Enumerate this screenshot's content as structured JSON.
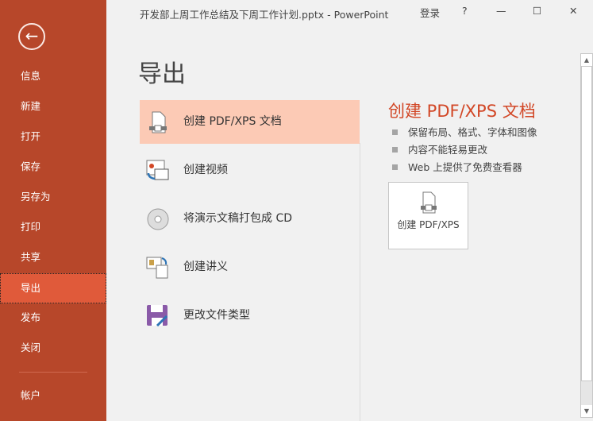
{
  "window": {
    "title": "开发部上周工作总结及下周工作计划.pptx - PowerPoint",
    "signin": "登录",
    "help": "?",
    "minimize": "—",
    "maximize": "☐",
    "close": "✕"
  },
  "sidebar": {
    "back": "←",
    "items": [
      {
        "label": "信息"
      },
      {
        "label": "新建"
      },
      {
        "label": "打开"
      },
      {
        "label": "保存"
      },
      {
        "label": "另存为"
      },
      {
        "label": "打印"
      },
      {
        "label": "共享"
      },
      {
        "label": "导出",
        "selected": true
      },
      {
        "label": "发布"
      },
      {
        "label": "关闭"
      },
      {
        "label": "帐户"
      }
    ]
  },
  "main": {
    "title": "导出",
    "options": [
      {
        "label": "创建 PDF/XPS 文档",
        "icon": "pdf-document-icon"
      },
      {
        "label": "创建视频",
        "icon": "video-icon"
      },
      {
        "label": "将演示文稿打包成 CD",
        "icon": "cd-icon"
      },
      {
        "label": "创建讲义",
        "icon": "handout-icon"
      },
      {
        "label": "更改文件类型",
        "icon": "save-as-type-icon"
      }
    ]
  },
  "detail": {
    "title": "创建 PDF/XPS 文档",
    "bullets": [
      "保留布局、格式、字体和图像",
      "内容不能轻易更改",
      "Web 上提供了免费查看器"
    ],
    "button": "创建 PDF/XPS"
  },
  "colors": {
    "sidebar": "#b7472a",
    "selected_nav": "#e05a3a",
    "selected_option": "#fccab5",
    "accent": "#d24726"
  }
}
